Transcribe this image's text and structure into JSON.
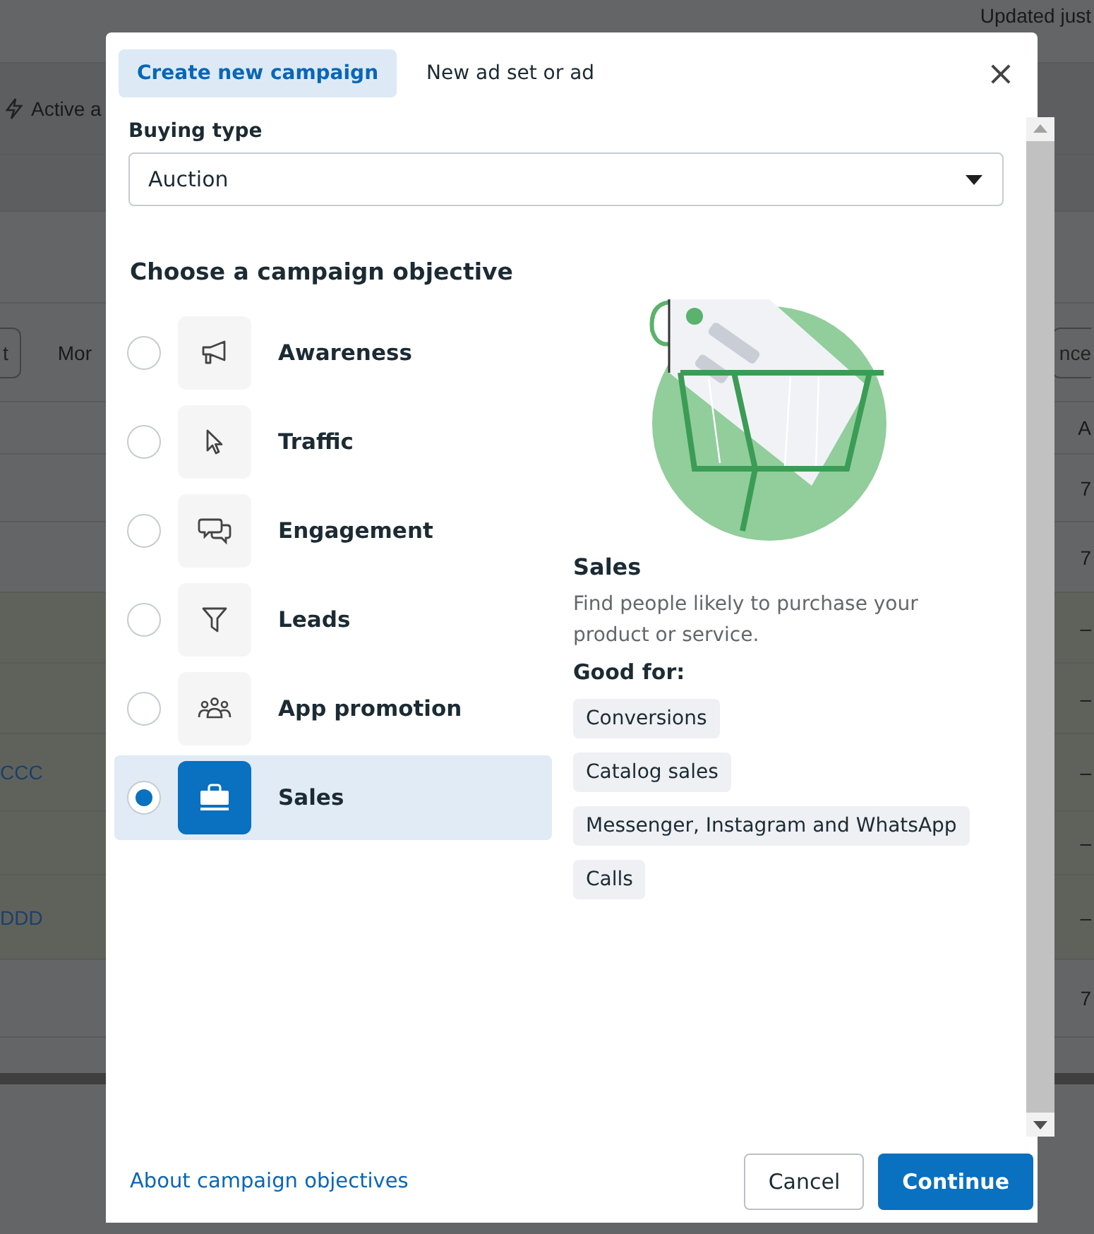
{
  "background_page": {
    "rows": [
      {
        "right": [
          {
            "kind": "text",
            "text": "Updated just"
          }
        ]
      },
      {
        "left": [
          {
            "kind": "status",
            "text": "Active a"
          }
        ]
      },
      {},
      {},
      {
        "left": [
          {
            "kind": "button",
            "text": "t"
          },
          {
            "kind": "text",
            "text": "Mor"
          }
        ],
        "right": [
          {
            "kind": "button",
            "text": "nce"
          }
        ]
      },
      {
        "right": [
          {
            "kind": "text",
            "text": "A"
          }
        ]
      },
      {
        "right": [
          {
            "kind": "text",
            "text": "7"
          }
        ]
      },
      {
        "right": [
          {
            "kind": "text",
            "text": "7"
          }
        ]
      },
      {
        "right": [
          {
            "kind": "text",
            "text": "–"
          }
        ]
      },
      {
        "right": [
          {
            "kind": "text",
            "text": "–"
          }
        ]
      },
      {
        "left": [
          {
            "kind": "link",
            "text": "CCC"
          }
        ],
        "right": [
          {
            "kind": "text",
            "text": "–"
          }
        ]
      },
      {
        "right": [
          {
            "kind": "text",
            "text": "–"
          }
        ]
      },
      {
        "left": [
          {
            "kind": "link",
            "text": "DDD"
          }
        ],
        "right": [
          {
            "kind": "text",
            "text": "–"
          }
        ]
      },
      {
        "right": [
          {
            "kind": "text",
            "text": "7"
          }
        ]
      }
    ]
  },
  "dialog": {
    "tabs": [
      {
        "label": "Create new campaign",
        "selected": true
      },
      {
        "label": "New ad set or ad",
        "selected": false
      }
    ],
    "close": "×",
    "buying_type": {
      "label": "Buying type",
      "value": "Auction"
    },
    "objective_heading": "Choose a campaign objective",
    "objectives": [
      {
        "label": "Awareness",
        "selected": false
      },
      {
        "label": "Traffic",
        "selected": false
      },
      {
        "label": "Engagement",
        "selected": false
      },
      {
        "label": "Leads",
        "selected": false
      },
      {
        "label": "App promotion",
        "selected": false
      },
      {
        "label": "Sales",
        "selected": true
      }
    ],
    "detail": {
      "title": "Sales",
      "description": "Find people likely to purchase your product or service.",
      "good_for_label": "Good for:",
      "tags": [
        "Conversions",
        "Catalog sales",
        "Messenger, Instagram and WhatsApp",
        "Calls"
      ]
    },
    "footer": {
      "link": "About campaign objectives",
      "cancel": "Cancel",
      "continue": "Continue"
    }
  }
}
